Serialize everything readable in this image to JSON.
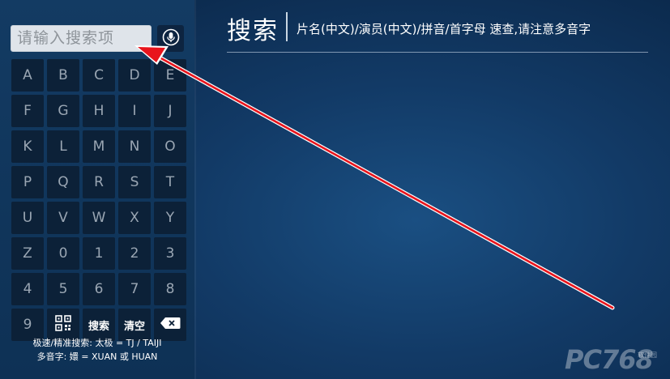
{
  "search": {
    "placeholder": "请输入搜索项"
  },
  "header": {
    "title": "搜索",
    "subtitle": "片名(中文)/演员(中文)/拼音/首字母 速查,请注意多音字"
  },
  "keyboard": {
    "keys": [
      "A",
      "B",
      "C",
      "D",
      "E",
      "F",
      "G",
      "H",
      "I",
      "J",
      "K",
      "L",
      "M",
      "N",
      "O",
      "P",
      "Q",
      "R",
      "S",
      "T",
      "U",
      "V",
      "W",
      "X",
      "Y",
      "Z",
      "0",
      "1",
      "2",
      "3",
      "4",
      "5",
      "6",
      "7",
      "8",
      "9"
    ],
    "search_label": "搜索",
    "clear_label": "清空"
  },
  "hints": {
    "line1": "极速/精准搜索: 太极 = TJ / TAIJI",
    "line2": "多音字: 嬛 = XUAN 或 HUAN"
  },
  "watermark": {
    "text": "PC768",
    "sub": "软件园"
  },
  "icons": {
    "mic": "microphone-icon",
    "qr": "qr-code-icon",
    "backspace": "backspace-icon"
  },
  "colors": {
    "background": "#123a66",
    "panel": "#133b63",
    "key": "#0c2138",
    "arrow": "#e8141c"
  }
}
